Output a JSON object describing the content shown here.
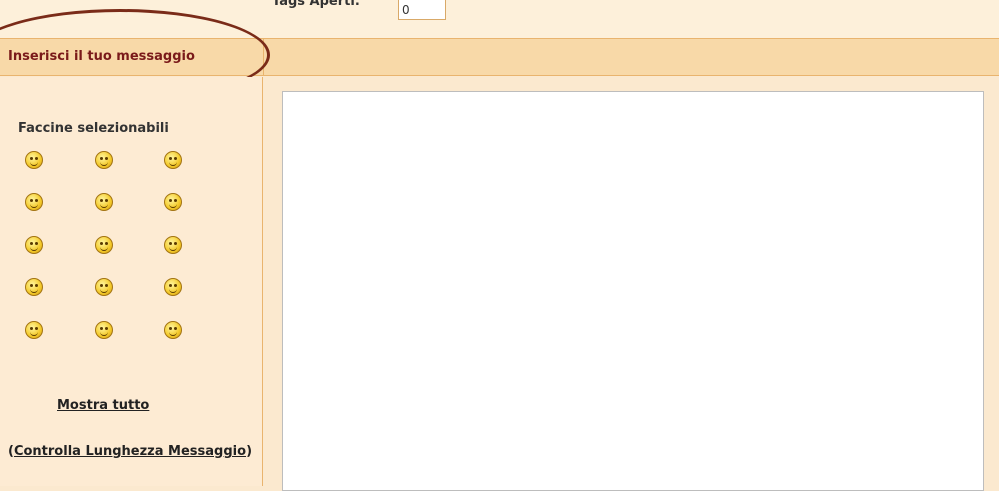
{
  "tags": {
    "label": "Tags Aperti:",
    "value": "0"
  },
  "header": {
    "title": "Inserisci il tuo messaggio"
  },
  "smilies": {
    "title": "Faccine selezionabili",
    "icons": [
      "smiley-icon",
      "smiley-icon",
      "smiley-icon",
      "smiley-icon",
      "smiley-icon",
      "smiley-icon",
      "smiley-icon",
      "smiley-icon",
      "smiley-icon",
      "smiley-icon",
      "smiley-icon",
      "smiley-icon",
      "smiley-icon",
      "smiley-icon",
      "smiley-icon"
    ]
  },
  "links": {
    "show_all": "Mostra tutto",
    "check_length_open": "(",
    "check_length": "Controlla Lunghezza Messaggio",
    "check_length_close": ")"
  },
  "editor": {
    "value": ""
  },
  "colors": {
    "header_text": "#7a1a1a",
    "highlight_ellipse": "#7a2b18",
    "background": "#fbe9cf"
  }
}
